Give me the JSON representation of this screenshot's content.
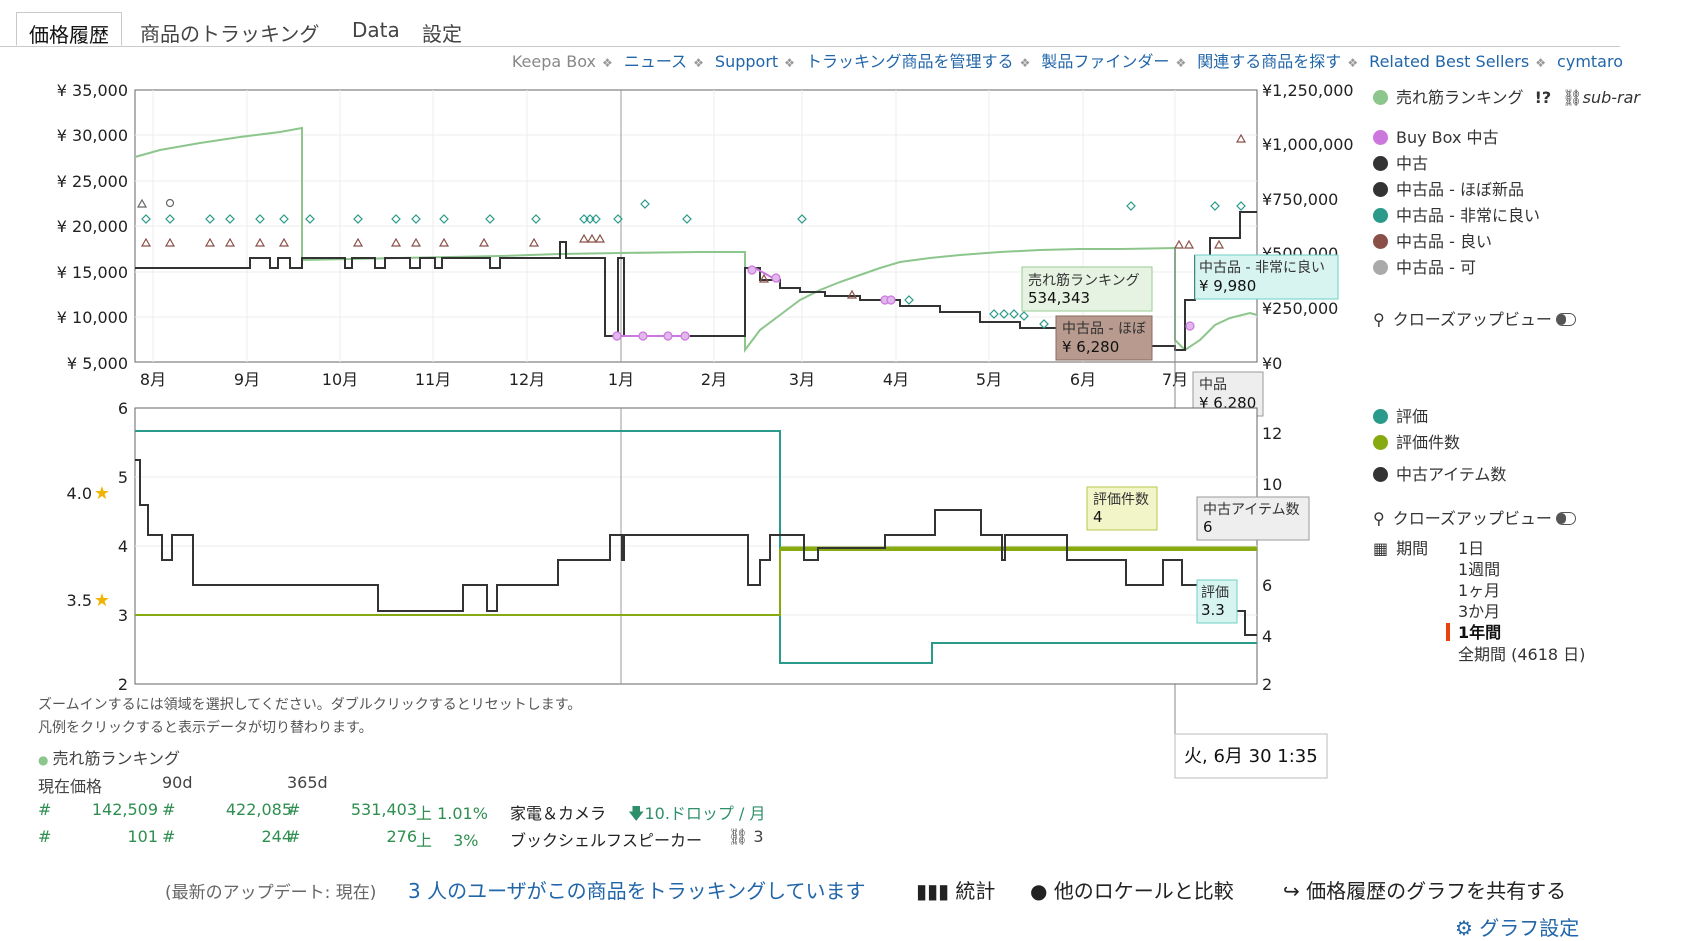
{
  "tabs": [
    {
      "label": "価格履歴"
    },
    {
      "label": "商品のトラッキング"
    },
    {
      "label": "Data"
    },
    {
      "label": "設定"
    }
  ],
  "topnav": {
    "keepa_box": "Keepa Box",
    "links": [
      "ニュース",
      "Support",
      "トラッキング商品を管理する",
      "製品ファインダー",
      "関連する商品を探す",
      "Related Best Sellers",
      "cymtaro"
    ]
  },
  "upper_chart": {
    "y_left_ticks": [
      "¥ 35,000",
      "¥ 30,000",
      "¥ 25,000",
      "¥ 20,000",
      "¥ 15,000",
      "¥ 10,000",
      "¥ 5,000"
    ],
    "y_right_ticks": [
      "¥1,250,000",
      "¥1,000,000",
      "¥750,000",
      "¥500,000",
      "¥250,000",
      "¥0"
    ],
    "x_ticks": [
      "8月",
      "9月",
      "10月",
      "11月",
      "12月",
      "1月",
      "2月",
      "3月",
      "4月",
      "5月",
      "6月",
      "7月"
    ],
    "tooltips": {
      "rank_label": "売れ筋ランキング",
      "rank_value": "534,343",
      "very_good_label": "中古品 - 非常に良い",
      "very_good_value": "¥ 9,980",
      "like_new_label": "中古品 - ほぼ",
      "like_new_value": "¥ 6,280",
      "used_label": "中品",
      "used_value": "¥ 6,280"
    }
  },
  "lower_chart": {
    "y_left_ticks": [
      "6",
      "5",
      "4",
      "3",
      "2"
    ],
    "star_labels": [
      "4.0",
      "3.5"
    ],
    "y_right_ticks": [
      "12",
      "10",
      "8",
      "6",
      "4",
      "2"
    ],
    "tooltips": {
      "rating_count_label": "評価件数",
      "rating_count_value": "4",
      "used_items_label": "中古アイテム数",
      "used_items_value": "6",
      "rating_label": "評価",
      "rating_value": "3.3"
    },
    "date_tooltip": "火, 6月 30 1:35"
  },
  "legend_upper": {
    "items": [
      {
        "label": "売れ筋ランキング",
        "color": "#8cc68c"
      },
      {
        "label": "Buy Box 中古",
        "color": "#cc77dd"
      },
      {
        "label": "中古",
        "color": "#333333"
      },
      {
        "label": "中古品 - ほぼ新品",
        "color": "#333333"
      },
      {
        "label": "中古品 - 非常に良い",
        "color": "#2a9a8a"
      },
      {
        "label": "中古品 - 良い",
        "color": "#8a5048"
      },
      {
        "label": "中古品 - 可",
        "color": "#aaaaaa"
      }
    ],
    "rank_extra": "sub-rar",
    "closeup": "クローズアップビュー"
  },
  "legend_lower": {
    "items": [
      {
        "label": "評価",
        "color": "#2a9a8a"
      },
      {
        "label": "評価件数",
        "color": "#88aa11"
      },
      {
        "label": "中古アイテム数",
        "color": "#333333"
      }
    ],
    "closeup": "クローズアップビュー",
    "period_label": "期間",
    "periods": [
      "1日",
      "1週間",
      "1ヶ月",
      "3か月",
      "1年間",
      "全期間 (4618 日)"
    ],
    "selected_period": "1年間"
  },
  "hints": {
    "line1": "ズームインするには領域を選択してください。ダブルクリックするとリセットします。",
    "line2": "凡例をクリックすると表示データが切り替わります。"
  },
  "stats": {
    "title": "売れ筋ランキング",
    "headers": [
      "現在価格",
      "90d",
      "365d"
    ],
    "rows": [
      {
        "cur": "142,509",
        "d90": "422,085",
        "d365": "531,403",
        "trend": "上 1.01%",
        "category": "家電＆カメラ",
        "drops": "10.ドロップ / 月"
      },
      {
        "cur": "101",
        "d90": "244",
        "d365": "276",
        "trend": "上　 3%",
        "category": "ブックシェルフスピーカー",
        "drops": "3"
      }
    ]
  },
  "bottom": {
    "update": "(最新のアップデート: 現在)",
    "tracking": "3 人のユーザがこの商品をトラッキングしています",
    "stats": "統計",
    "compare": "他のロケールと比較",
    "share": "価格履歴のグラフを共有する",
    "settings": "グラフ設定"
  }
}
